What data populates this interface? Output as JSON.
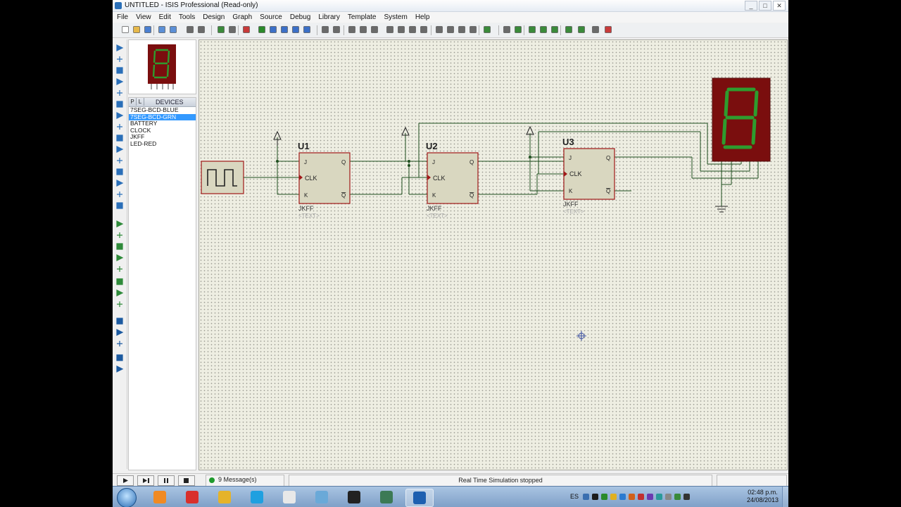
{
  "window": {
    "title": "UNTITLED - ISIS Professional (Read-only)",
    "controls": {
      "minimize": "_",
      "maximize": "□",
      "close": "✕"
    }
  },
  "menu": [
    "File",
    "View",
    "Edit",
    "Tools",
    "Design",
    "Graph",
    "Source",
    "Debug",
    "Library",
    "Template",
    "System",
    "Help"
  ],
  "toolbar_icons": [
    "new-icon",
    "open-icon",
    "save-icon",
    "import-icon",
    "export-icon",
    "print-icon",
    "print-area-icon",
    "refresh-icon",
    "grid-icon",
    "origin-icon",
    "pan-icon",
    "zoom-in-icon",
    "zoom-out-icon",
    "zoom-all-icon",
    "zoom-area-icon",
    "undo-icon",
    "redo-icon",
    "cut-icon",
    "copy-icon",
    "paste-icon",
    "block-copy-icon",
    "block-move-icon",
    "block-rotate-icon",
    "block-delete-icon",
    "pick-device-icon",
    "make-device-icon",
    "packaging-icon",
    "decompose-icon",
    "wire-autorouter-icon",
    "search-icon",
    "property-tool-icon",
    "design-explorer-icon",
    "new-sheet-icon",
    "remove-sheet-icon",
    "exit-to-parent-icon",
    "bill-of-materials-icon",
    "electrical-rules-icon",
    "netlist-icon"
  ],
  "left_tools": [
    "selection-mode-icon",
    "component-mode-icon",
    "junction-dot-icon",
    "wire-label-icon",
    "text-script-icon",
    "buses-icon",
    "subcircuit-icon",
    "terminals-icon",
    "device-pins-icon",
    "graph-icon",
    "tape-recorder-icon",
    "generator-icon",
    "voltage-probe-icon",
    "current-probe-icon",
    "virtual-instruments-icon",
    "line-icon",
    "box-icon",
    "circle-icon",
    "arc-icon",
    "path-icon",
    "text-icon",
    "symbol-icon",
    "marker-icon",
    "rotate-cw-icon",
    "rotate-ccw-icon",
    "angle-icon",
    "mirror-x-icon",
    "mirror-y-icon"
  ],
  "device_panel": {
    "tabs": [
      "P",
      "L"
    ],
    "title": "DEVICES",
    "items": [
      {
        "label": "7SEG-BCD-BLUE",
        "selected": false
      },
      {
        "label": "7SEG-BCD-GRN",
        "selected": true
      },
      {
        "label": "BATTERY",
        "selected": false
      },
      {
        "label": "CLOCK",
        "selected": false
      },
      {
        "label": "JKFF",
        "selected": false
      },
      {
        "label": "LED-RED",
        "selected": false
      }
    ]
  },
  "schematic": {
    "flipflops": [
      {
        "ref": "U1",
        "type": "JKFF",
        "text": "<TEXT>",
        "pins": {
          "j": "J",
          "clk": "CLK",
          "k": "K",
          "q": "Q",
          "qbar": "Q"
        }
      },
      {
        "ref": "U2",
        "type": "JKFF",
        "text": "<TEXT>",
        "pins": {
          "j": "J",
          "clk": "CLK",
          "k": "K",
          "q": "Q",
          "qbar": "Q"
        }
      },
      {
        "ref": "U3",
        "type": "JKFF",
        "text": "<TEXT>",
        "pins": {
          "j": "J",
          "clk": "CLK",
          "k": "K",
          "q": "Q",
          "qbar": "Q"
        }
      }
    ],
    "display_digit": "8",
    "colors": {
      "segment_on": "#2e9c2e",
      "display_body": "#7a0e0e",
      "component_fill": "#d9d7c0",
      "component_border": "#a01818",
      "wire": "#1f4f1f"
    }
  },
  "status": {
    "messages": "9 Message(s)",
    "simulation": "Real Time Simulation stopped",
    "sim_buttons": [
      "play-icon",
      "step-icon",
      "pause-icon",
      "stop-icon"
    ]
  },
  "taskbar": {
    "apps": [
      "windows-media-player-icon",
      "pdf-icon",
      "chrome-icon",
      "skype-icon",
      "game-icon",
      "notepad-icon",
      "phone-icon",
      "tools-icon",
      "isis-icon"
    ],
    "language": "ES",
    "time": "02:48 p.m.",
    "date": "24/08/2013"
  }
}
